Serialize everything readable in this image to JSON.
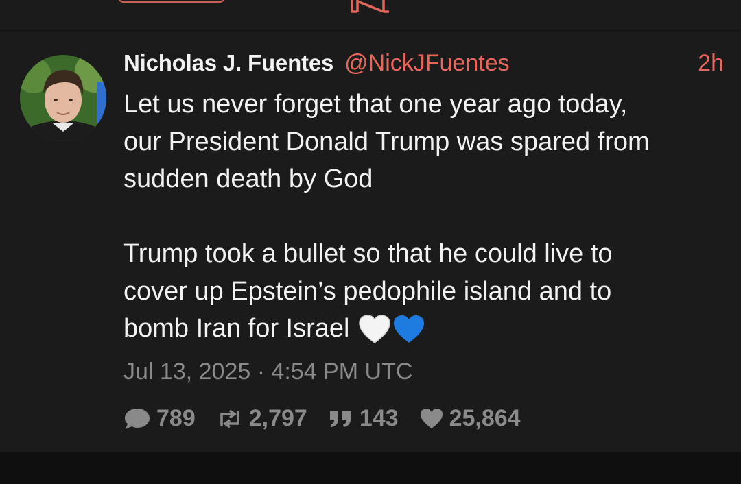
{
  "tweet": {
    "author_name": "Nicholas J. Fuentes",
    "handle": "@NickJFuentes",
    "relative_time": "2h",
    "text": "Let us never forget that one year ago today,\nour President Donald Trump was spared from\nsudden death by God\n\nTrump took a bullet so that he could live to\ncover up Epstein’s pedophile island and to\nbomb Iran for Israel",
    "emoji": [
      "white-heart",
      "blue-heart"
    ],
    "timestamp": "Jul 13, 2025 · 4:54 PM UTC",
    "stats": {
      "replies": "789",
      "retweets": "2,797",
      "quotes": "143",
      "likes": "25,864"
    }
  },
  "colors": {
    "accent": "#e8675a",
    "background": "#1b1b1b",
    "text": "#f2f2f2",
    "muted": "#8a8a8a"
  }
}
